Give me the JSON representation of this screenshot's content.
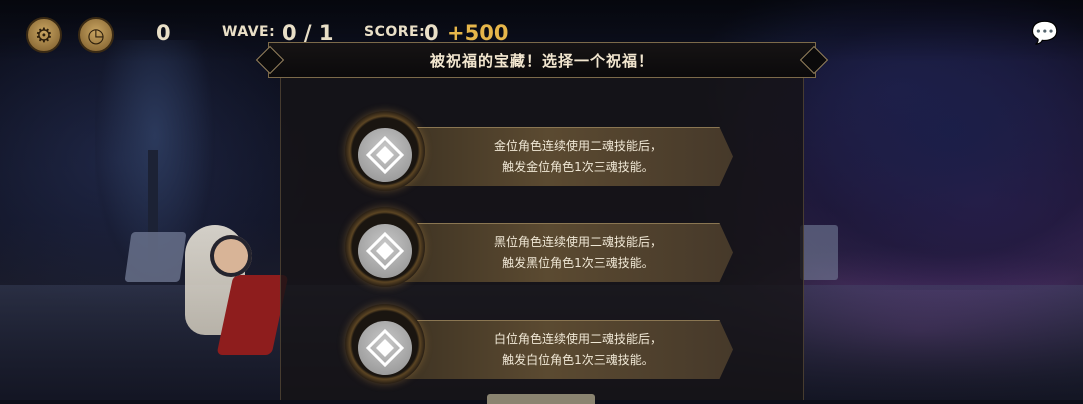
{
  "hud": {
    "settings_icon": "gear-icon",
    "speed_icon": "clock-icon",
    "timer_value": "0",
    "wave_label": "WAVE:",
    "wave_value": "0 / 1",
    "score_label": "SCORE:",
    "score_value": "0",
    "score_bonus": "+500",
    "chat_icon": "chat-bubble-icon"
  },
  "dialog": {
    "title": "被祝福的宝藏！选择一个祝福！",
    "options": [
      {
        "line1": "金位角色连续使用二魂技能后，",
        "line2": "触发金位角色1次三魂技能。",
        "icon": "diamond-emblem-icon"
      },
      {
        "line1": "黑位角色连续使用二魂技能后，",
        "line2": "触发黑位角色1次三魂技能。",
        "icon": "diamond-emblem-icon"
      },
      {
        "line1": "白位角色连续使用二魂技能后，",
        "line2": "触发白位角色1次三魂技能。",
        "icon": "diamond-emblem-icon"
      }
    ]
  },
  "colors": {
    "accent_gold": "#e6b64a",
    "panel_bg": "#161314",
    "banner": "#5b4a31"
  }
}
